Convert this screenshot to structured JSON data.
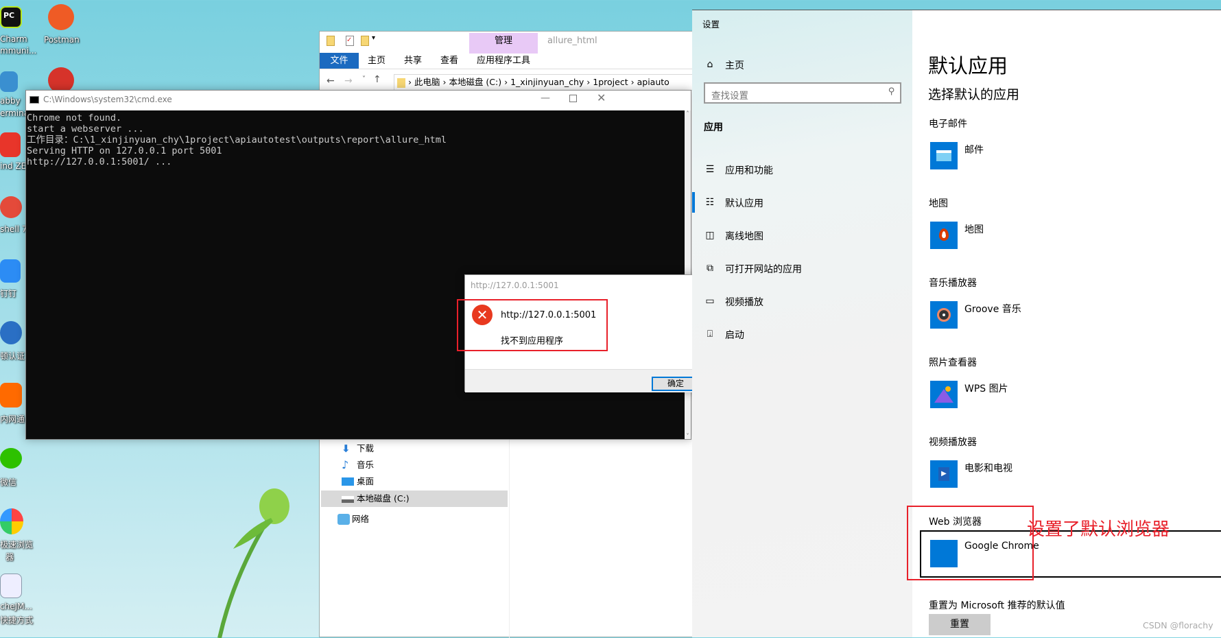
{
  "desktop": {
    "icons": [
      {
        "label": "Charm",
        "label2": "mmuni..."
      },
      {
        "label": "Postman"
      },
      {
        "label": "abby",
        "label2": "ermina"
      },
      {
        "label": "ind ZE"
      },
      {
        "label": "shell 7"
      },
      {
        "label": "钉钉"
      },
      {
        "label": "顿认证"
      },
      {
        "label": "内网通"
      },
      {
        "label": "微信"
      },
      {
        "label": "极速浏览",
        "label2": "器"
      },
      {
        "label": "cheJM...",
        "label2": "快捷方式"
      }
    ]
  },
  "explorer": {
    "title": "allure_html",
    "manage_tab": "管理",
    "tabs": [
      "文件",
      "主页",
      "共享",
      "查看"
    ],
    "app_tools_tab": "应用程序工具",
    "breadcrumb": [
      "此电脑",
      "本地磁盘 (C:)",
      "1_xinjinyuan_chy",
      "1project",
      "apiauto"
    ],
    "nav_items": [
      {
        "label": "下载",
        "icon": "download-icon"
      },
      {
        "label": "音乐",
        "icon": "music-icon"
      },
      {
        "label": "桌面",
        "icon": "desktop-icon"
      },
      {
        "label": "本地磁盘 (C:)",
        "icon": "drive-icon",
        "selected": true
      },
      {
        "label": "网络",
        "icon": "network-icon"
      }
    ]
  },
  "cmd": {
    "title": "C:\\Windows\\system32\\cmd.exe",
    "lines": [
      "Chrome not found.",
      "start a webserver ...",
      "工作目录：C:\\1_xinjinyuan_chy\\1project\\apiautotest\\outputs\\report\\allure_html",
      "Serving HTTP on 127.0.0.1 port 5001",
      "http://127.0.0.1:5001/ ..."
    ]
  },
  "dialog": {
    "title": "http://127.0.0.1:5001",
    "message_url": "http://127.0.0.1:5001",
    "message": "找不到应用程序",
    "ok_label": "确定"
  },
  "settings": {
    "window_title": "设置",
    "home": "主页",
    "search_placeholder": "查找设置",
    "group": "应用",
    "nav": [
      {
        "label": "应用和功能",
        "icon": "apps-list-icon"
      },
      {
        "label": "默认应用",
        "icon": "default-apps-icon",
        "selected": true
      },
      {
        "label": "离线地图",
        "icon": "offline-map-icon"
      },
      {
        "label": "可打开网站的应用",
        "icon": "open-website-icon"
      },
      {
        "label": "视频播放",
        "icon": "video-icon"
      },
      {
        "label": "启动",
        "icon": "startup-icon"
      }
    ],
    "page_title": "默认应用",
    "subtitle": "选择默认的应用",
    "sections": [
      {
        "heading": "电子邮件",
        "app": "邮件"
      },
      {
        "heading": "地图",
        "app": "地图"
      },
      {
        "heading": "音乐播放器",
        "app": "Groove 音乐"
      },
      {
        "heading": "照片查看器",
        "app": "WPS 图片"
      },
      {
        "heading": "视频播放器",
        "app": "电影和电视"
      },
      {
        "heading": "Web 浏览器",
        "app": "Google Chrome"
      }
    ],
    "reset_label": "重置为 Microsoft 推荐的默认值",
    "reset_button": "重置",
    "accent": "#0078d7"
  },
  "annotation": {
    "text": "设置了默认浏览器",
    "color": "#e8202a"
  },
  "watermark": "CSDN @florachy"
}
